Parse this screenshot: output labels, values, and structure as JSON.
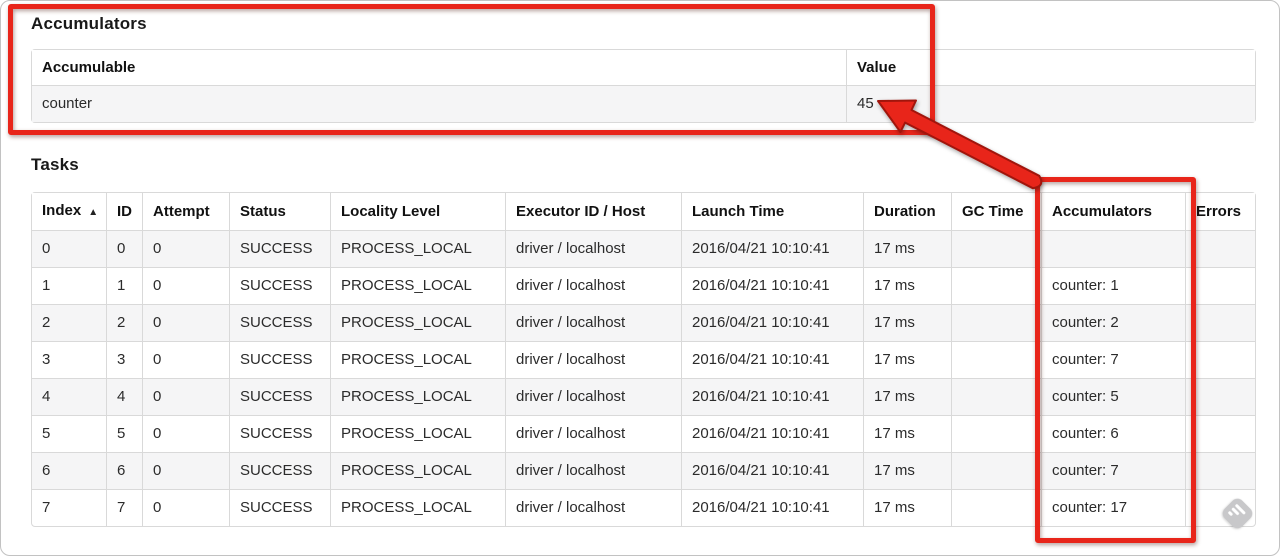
{
  "accumulators": {
    "title": "Accumulators",
    "headers": [
      "Accumulable",
      "Value"
    ],
    "rows": [
      [
        "counter",
        "45"
      ]
    ]
  },
  "tasks": {
    "title": "Tasks",
    "headers": [
      {
        "label": "Index",
        "sort_icon": "▲"
      },
      {
        "label": "ID"
      },
      {
        "label": "Attempt"
      },
      {
        "label": "Status"
      },
      {
        "label": "Locality Level"
      },
      {
        "label": "Executor ID / Host"
      },
      {
        "label": "Launch Time"
      },
      {
        "label": "Duration"
      },
      {
        "label": "GC Time"
      },
      {
        "label": "Accumulators"
      },
      {
        "label": "Errors"
      }
    ],
    "rows": [
      [
        "0",
        "0",
        "0",
        "SUCCESS",
        "PROCESS_LOCAL",
        "driver / localhost",
        "2016/04/21 10:10:41",
        "17 ms",
        "",
        "",
        ""
      ],
      [
        "1",
        "1",
        "0",
        "SUCCESS",
        "PROCESS_LOCAL",
        "driver / localhost",
        "2016/04/21 10:10:41",
        "17 ms",
        "",
        "counter: 1",
        ""
      ],
      [
        "2",
        "2",
        "0",
        "SUCCESS",
        "PROCESS_LOCAL",
        "driver / localhost",
        "2016/04/21 10:10:41",
        "17 ms",
        "",
        "counter: 2",
        ""
      ],
      [
        "3",
        "3",
        "0",
        "SUCCESS",
        "PROCESS_LOCAL",
        "driver / localhost",
        "2016/04/21 10:10:41",
        "17 ms",
        "",
        "counter: 7",
        ""
      ],
      [
        "4",
        "4",
        "0",
        "SUCCESS",
        "PROCESS_LOCAL",
        "driver / localhost",
        "2016/04/21 10:10:41",
        "17 ms",
        "",
        "counter: 5",
        ""
      ],
      [
        "5",
        "5",
        "0",
        "SUCCESS",
        "PROCESS_LOCAL",
        "driver / localhost",
        "2016/04/21 10:10:41",
        "17 ms",
        "",
        "counter: 6",
        ""
      ],
      [
        "6",
        "6",
        "0",
        "SUCCESS",
        "PROCESS_LOCAL",
        "driver / localhost",
        "2016/04/21 10:10:41",
        "17 ms",
        "",
        "counter: 7",
        ""
      ],
      [
        "7",
        "7",
        "0",
        "SUCCESS",
        "PROCESS_LOCAL",
        "driver / localhost",
        "2016/04/21 10:10:41",
        "17 ms",
        "",
        "counter: 17",
        ""
      ]
    ]
  },
  "annotations": {
    "color": "#e8251a",
    "box_1_target": "Accumulators summary table",
    "box_2_target": "Accumulators column of Tasks table",
    "arrow_points_to": "45"
  },
  "watermark": {
    "icon": "diamond-stripes-watermark-icon"
  }
}
